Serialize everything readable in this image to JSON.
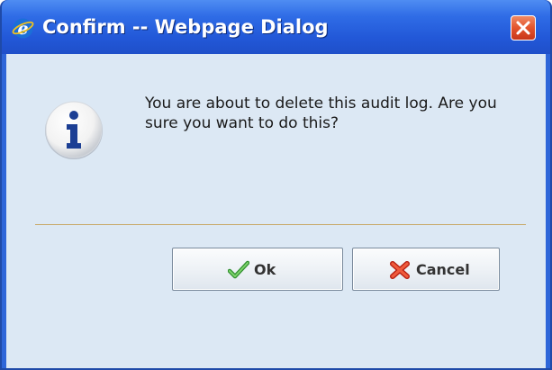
{
  "window": {
    "title": "Confirm -- Webpage Dialog",
    "title_icon": "ie-icon",
    "close_icon": "close-icon"
  },
  "dialog": {
    "icon": "info-icon",
    "message": "You are about to delete this audit log. Are you sure you want to do this?"
  },
  "buttons": {
    "ok": {
      "label": "Ok",
      "icon": "checkmark-icon"
    },
    "cancel": {
      "label": "Cancel",
      "icon": "red-x-icon"
    }
  },
  "colors": {
    "titlebar": "#2f6ce6",
    "client_background": "#dce8f4",
    "close_button": "#e3542c",
    "separator": "#c8a867"
  }
}
